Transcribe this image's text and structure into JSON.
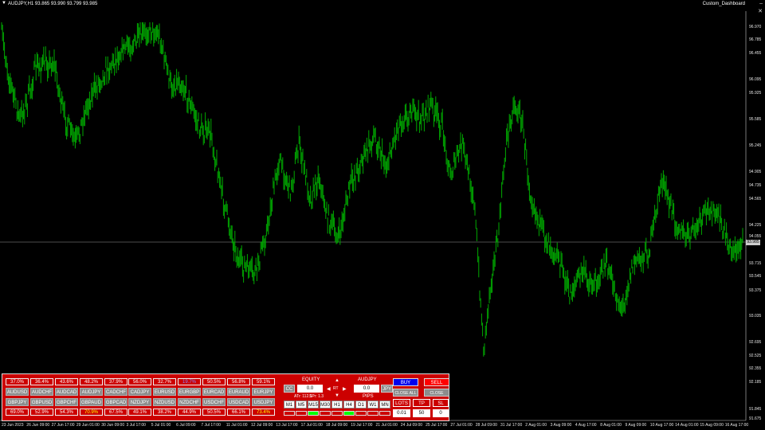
{
  "header": {
    "menu_glyph": "▼",
    "symbol_info": "AUDJPY,H1  93.865 93.990 93.799 93.985",
    "dashboard_name": "Custom_Dashboard",
    "window_controls": [
      "–",
      "✕"
    ]
  },
  "price_axis": {
    "labels": [
      "96.970",
      "96.785",
      "96.455",
      "96.095",
      "95.925",
      "95.585",
      "95.245",
      "94.905",
      "94.735",
      "94.565",
      "94.225",
      "94.055",
      "93.715",
      "93.545",
      "93.375",
      "93.035",
      "92.695",
      "92.525",
      "92.355",
      "92.185",
      "91.845",
      "91.675"
    ],
    "current_price": "93.985"
  },
  "time_axis": {
    "labels": [
      "23 Jun 2023",
      "26 Jun 09:00",
      "27 Jun 17:00",
      "29 Jun 01:00",
      "30 Jun 09:00",
      "3 Jul 17:00",
      "5 Jul 01:00",
      "6 Jul 09:00",
      "7 Jul 17:00",
      "11 Jul 01:00",
      "12 Jul 09:00",
      "13 Jul 17:00",
      "17 Jul 01:00",
      "18 Jul 09:00",
      "19 Jul 17:00",
      "21 Jul 01:00",
      "24 Jul 09:00",
      "25 Jul 17:00",
      "27 Jul 01:00",
      "28 Jul 09:00",
      "31 Jul 17:00",
      "2 Aug 01:00",
      "3 Aug 09:00",
      "4 Aug 17:00",
      "8 Aug 01:00",
      "9 Aug 09:00",
      "10 Aug 17:00",
      "14 Aug 01:00",
      "15 Aug 09:00",
      "16 Aug 17:00"
    ]
  },
  "colors": {
    "candles": "#00a800",
    "panel": "#cc0000",
    "buy": "#0000ee",
    "sell": "#ff0000",
    "positive": "#ffff00",
    "negative": "#8888ff"
  },
  "dashboard": {
    "rows": [
      [
        {
          "pct": "37.0%",
          "pair": "AUDUSD"
        },
        {
          "pct": "36.4%",
          "pair": "AUDCHF"
        },
        {
          "pct": "43.6%",
          "pair": "AUDCAD"
        },
        {
          "pct": "48.2%",
          "pair": "AUDJPY"
        },
        {
          "pct": "37.9%",
          "pair": "CADCHF"
        },
        {
          "pct": "56.0%",
          "pair": "CADJPY"
        },
        {
          "pct": "32.7%",
          "pair": "EURUSD"
        },
        {
          "pct": "19.7%",
          "pair": "EURGBP",
          "tone": "neg"
        },
        {
          "pct": "50.5%",
          "pair": "EURCAD"
        },
        {
          "pct": "56.8%",
          "pair": "EURAUD"
        },
        {
          "pct": "59.1%",
          "pair": "EURJPY"
        }
      ],
      [
        {
          "pct": "69.0%",
          "pair": "GBPJPY"
        },
        {
          "pct": "52.9%",
          "pair": "GBPUSD"
        },
        {
          "pct": "54.3%",
          "pair": "GBPCHF"
        },
        {
          "pct": "70.9%",
          "pair": "GBPAUD",
          "tone": "pos"
        },
        {
          "pct": "67.5%",
          "pair": "GBPCAD"
        },
        {
          "pct": "49.1%",
          "pair": "NZDJPY"
        },
        {
          "pct": "38.2%",
          "pair": "NZDUSD"
        },
        {
          "pct": "44.9%",
          "pair": "NZDCHF"
        },
        {
          "pct": "50.5%",
          "pair": "USDCHF"
        },
        {
          "pct": "66.1%",
          "pair": "USDCAD"
        },
        {
          "pct": "73.4%",
          "pair": "USDJPY",
          "tone": "pos"
        }
      ]
    ],
    "equity_label": "EQUITY",
    "equity_value": "0.0",
    "cc_label": "CC",
    "symbol_label": "AUDJPY",
    "pips_value": "0.0",
    "currency_label": "JPY",
    "rt_label": "RT",
    "atr_text": "ATr: 112.1",
    "spr_text": "SPr: 1.3",
    "pips_label": "PIPS",
    "timeframes": [
      "M1",
      "M5",
      "M15",
      "M30",
      "H1",
      "H4",
      "D1",
      "W1",
      "MN"
    ],
    "timeframe_leds": [
      false,
      false,
      true,
      false,
      false,
      true,
      false,
      false,
      false
    ],
    "buy_label": "BUY",
    "sell_label": "SELL",
    "close_all_label": "CLOSE ALL",
    "close_label": "CLOSE",
    "lots_label": "LOTS",
    "tp_label": "TP",
    "sl_label": "SL",
    "lots_value": "0.01",
    "tp_value": "50",
    "sl_value": "0"
  }
}
